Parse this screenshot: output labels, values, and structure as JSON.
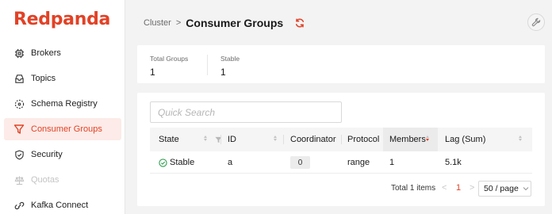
{
  "app": {
    "logo": "Redpanda",
    "brand_color": "#e14226"
  },
  "sidebar": {
    "items": [
      {
        "label": "Brokers",
        "icon": "chip-icon",
        "state": "normal"
      },
      {
        "label": "Topics",
        "icon": "inbox-icon",
        "state": "normal"
      },
      {
        "label": "Schema Registry",
        "icon": "schema-icon",
        "state": "normal"
      },
      {
        "label": "Consumer Groups",
        "icon": "funnel-icon",
        "state": "active"
      },
      {
        "label": "Security",
        "icon": "shield-icon",
        "state": "normal"
      },
      {
        "label": "Quotas",
        "icon": "scale-icon",
        "state": "disabled"
      },
      {
        "label": "Kafka Connect",
        "icon": "link-icon",
        "state": "normal"
      }
    ]
  },
  "header": {
    "breadcrumb": "Cluster",
    "separator": ">",
    "title": "Consumer Groups",
    "refresh_icon": "refresh-icon",
    "tools_icon": "wrench-icon"
  },
  "stats": {
    "total_groups_label": "Total Groups",
    "total_groups_value": "1",
    "stable_label": "Stable",
    "stable_value": "1"
  },
  "search": {
    "placeholder": "Quick Search",
    "value": ""
  },
  "table": {
    "columns": [
      "State",
      "ID",
      "Coordinator",
      "Protocol",
      "Members",
      "Lag (Sum)"
    ],
    "sorted_column": "Members",
    "rows": [
      {
        "state": "Stable",
        "id": "a",
        "coordinator": "0",
        "protocol": "range",
        "members": "1",
        "lag": "5.1k"
      }
    ]
  },
  "pagination": {
    "total": "Total 1 items",
    "prev": "<",
    "current_page": "1",
    "next": ">",
    "page_size": "50 / page"
  }
}
